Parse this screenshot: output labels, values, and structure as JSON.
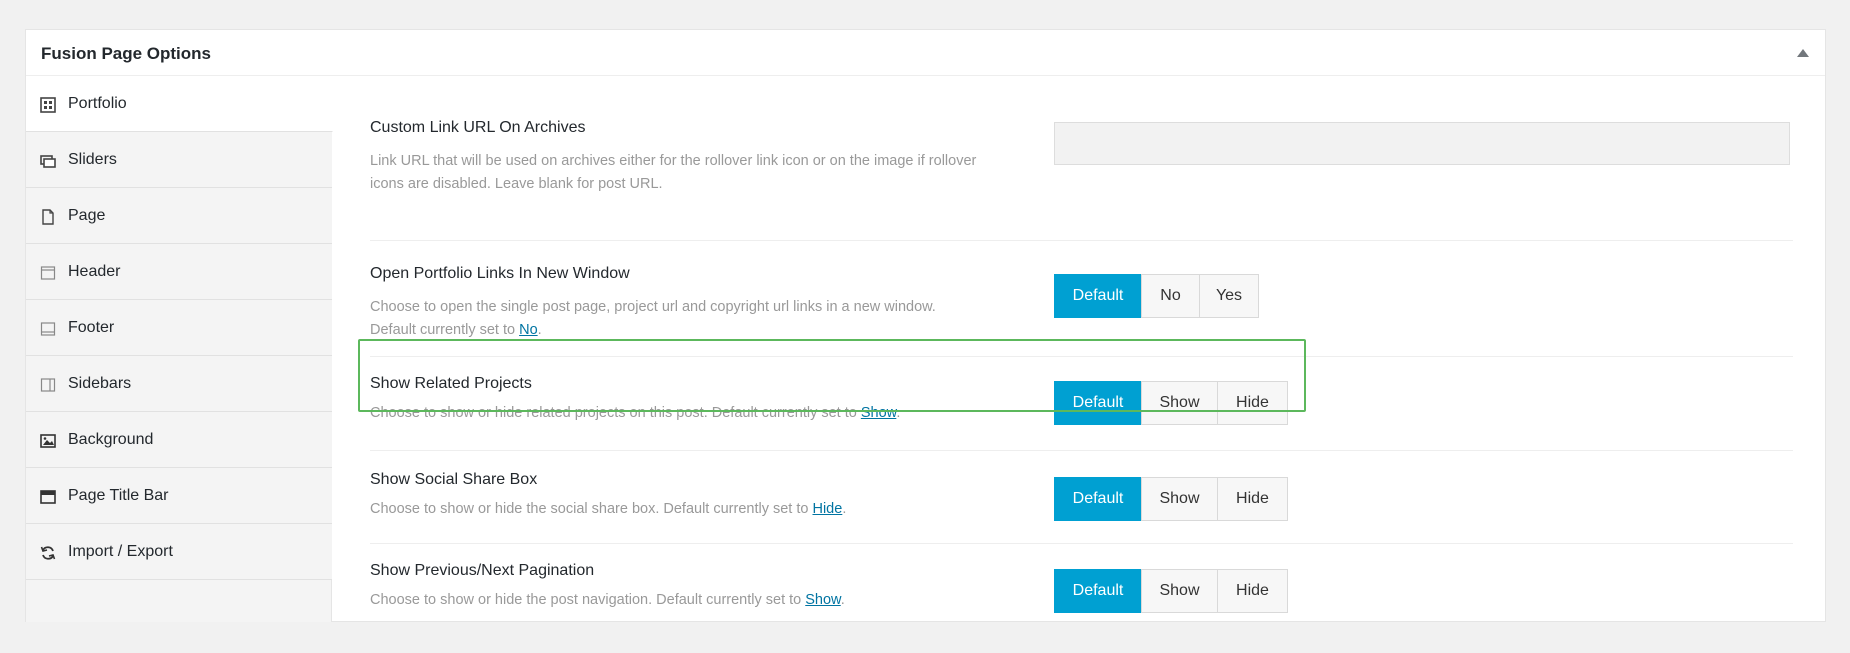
{
  "panel": {
    "title": "Fusion Page Options"
  },
  "sidebar": {
    "items": [
      {
        "label": "Portfolio",
        "icon": "portfolio-icon",
        "active": true
      },
      {
        "label": "Sliders",
        "icon": "sliders-icon"
      },
      {
        "label": "Page",
        "icon": "page-icon"
      },
      {
        "label": "Header",
        "icon": "header-icon"
      },
      {
        "label": "Footer",
        "icon": "footer-icon"
      },
      {
        "label": "Sidebars",
        "icon": "sidebars-icon"
      },
      {
        "label": "Background",
        "icon": "background-icon"
      },
      {
        "label": "Page Title Bar",
        "icon": "page-title-bar-icon"
      },
      {
        "label": "Import / Export",
        "icon": "import-export-icon"
      }
    ]
  },
  "options": {
    "custom_link": {
      "title": "Custom Link URL On Archives",
      "desc_line1": "Link URL that will be used on archives either for the rollover link icon or on the image if rollover",
      "desc_line2": "icons are disabled. Leave blank for post URL.",
      "value": "",
      "placeholder": ""
    },
    "new_window": {
      "title": "Open Portfolio Links In New Window",
      "desc_line1": "Choose to open the single post page, project url and copyright url links in a new window.",
      "desc_line2_prefix": "Default currently set to ",
      "desc_link": "No",
      "desc_suffix": ".",
      "buttons": [
        "Default",
        "No",
        "Yes"
      ],
      "selected": "Default"
    },
    "related_projects": {
      "title": "Show Related Projects",
      "desc_prefix": "Choose to show or hide related projects on this post. Default currently set to ",
      "desc_link": "Show",
      "desc_suffix": ".",
      "buttons": [
        "Default",
        "Show",
        "Hide"
      ],
      "selected": "Default"
    },
    "social_share": {
      "title": "Show Social Share Box",
      "desc_prefix": "Choose to show or hide the social share box. Default currently set to ",
      "desc_link": "Hide",
      "desc_suffix": ".",
      "buttons": [
        "Default",
        "Show",
        "Hide"
      ],
      "selected": "Default"
    },
    "pagination": {
      "title": "Show Previous/Next Pagination",
      "desc_prefix": "Choose to show or hide the post navigation. Default currently set to ",
      "desc_link": "Show",
      "desc_suffix": ".",
      "buttons": [
        "Default",
        "Show",
        "Hide"
      ],
      "selected": "Default"
    }
  },
  "colors": {
    "accent": "#00a0d2",
    "highlight": "#5cb85c",
    "link": "#0074a2"
  }
}
